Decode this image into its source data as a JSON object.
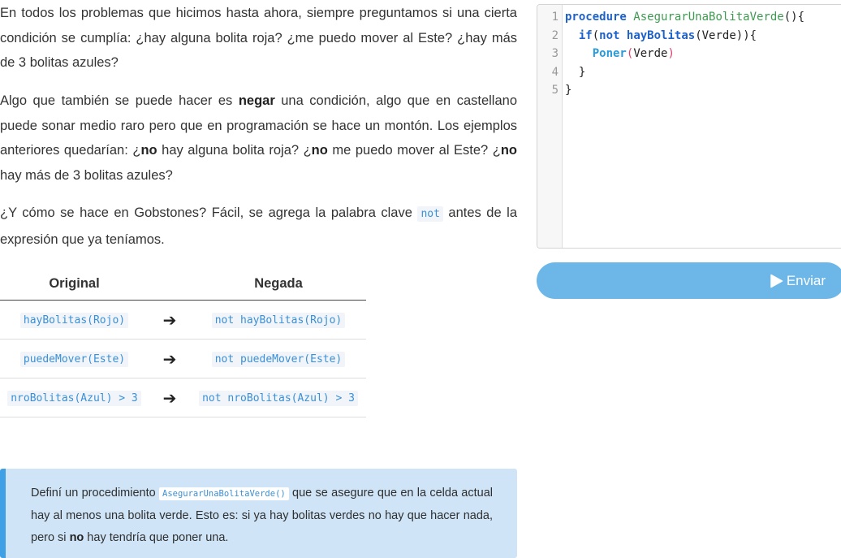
{
  "intro": {
    "p1": "En todos los problemas que hicimos hasta ahora, siempre preguntamos si una cierta condición se cumplía: ¿hay alguna bolita roja? ¿me puedo mover al Este? ¿hay más de 3 bolitas azules?",
    "p2_a": "Algo que también se puede hacer es ",
    "p2_b": "negar",
    "p2_c": " una condición, algo que en castellano puede sonar medio raro pero que en programación se hace un montón. Los ejemplos anteriores quedarían: ¿",
    "p2_d": "no",
    "p2_e": " hay alguna bolita roja? ¿",
    "p2_f": "no",
    "p2_g": " me puedo mover al Este? ¿",
    "p2_h": "no",
    "p2_i": " hay más de 3 bolitas azules?",
    "p3_a": "¿Y cómo se hace en Gobstones? Fácil, se agrega la palabra clave ",
    "p3_code": "not",
    "p3_b": " antes de la expresión que ya teníamos."
  },
  "table": {
    "headers": [
      "Original",
      "Negada"
    ],
    "arrow": "➔",
    "rows": [
      {
        "original": "hayBolitas(Rojo)",
        "negada": "not hayBolitas(Rojo)"
      },
      {
        "original": "puedeMover(Este)",
        "negada": "not puedeMover(Este)"
      },
      {
        "original": "nroBolitas(Azul) > 3",
        "negada": "not nroBolitas(Azul) > 3"
      }
    ]
  },
  "callout": {
    "a": "Definí un procedimiento ",
    "code": "AsegurarUnaBolitaVerde()",
    "b": " que se asegure que en la celda actual hay al menos una bolita verde. Esto es: si ya hay bolitas verdes no hay que hacer nada, pero si ",
    "c": "no",
    "d": " hay tendría que poner una."
  },
  "editor": {
    "line_numbers": [
      "1",
      "2",
      "3",
      "4",
      "5"
    ],
    "line1": {
      "kw": "procedure",
      "sp": " ",
      "name": "AsegurarUnaBolitaVerde",
      "rest": "(){"
    },
    "line2": {
      "indent": "  ",
      "kw": "if",
      "p1": "(",
      "not": "not",
      "sp": " ",
      "fn": "hayBolitas",
      "rest": "(Verde)){"
    },
    "line3": {
      "indent": "    ",
      "fn": "Poner",
      "po": "(",
      "arg": "Verde",
      "pc": ")"
    },
    "line4": "  }",
    "line5": "}"
  },
  "submit": {
    "label": "Enviar",
    "icon": "play-icon"
  }
}
